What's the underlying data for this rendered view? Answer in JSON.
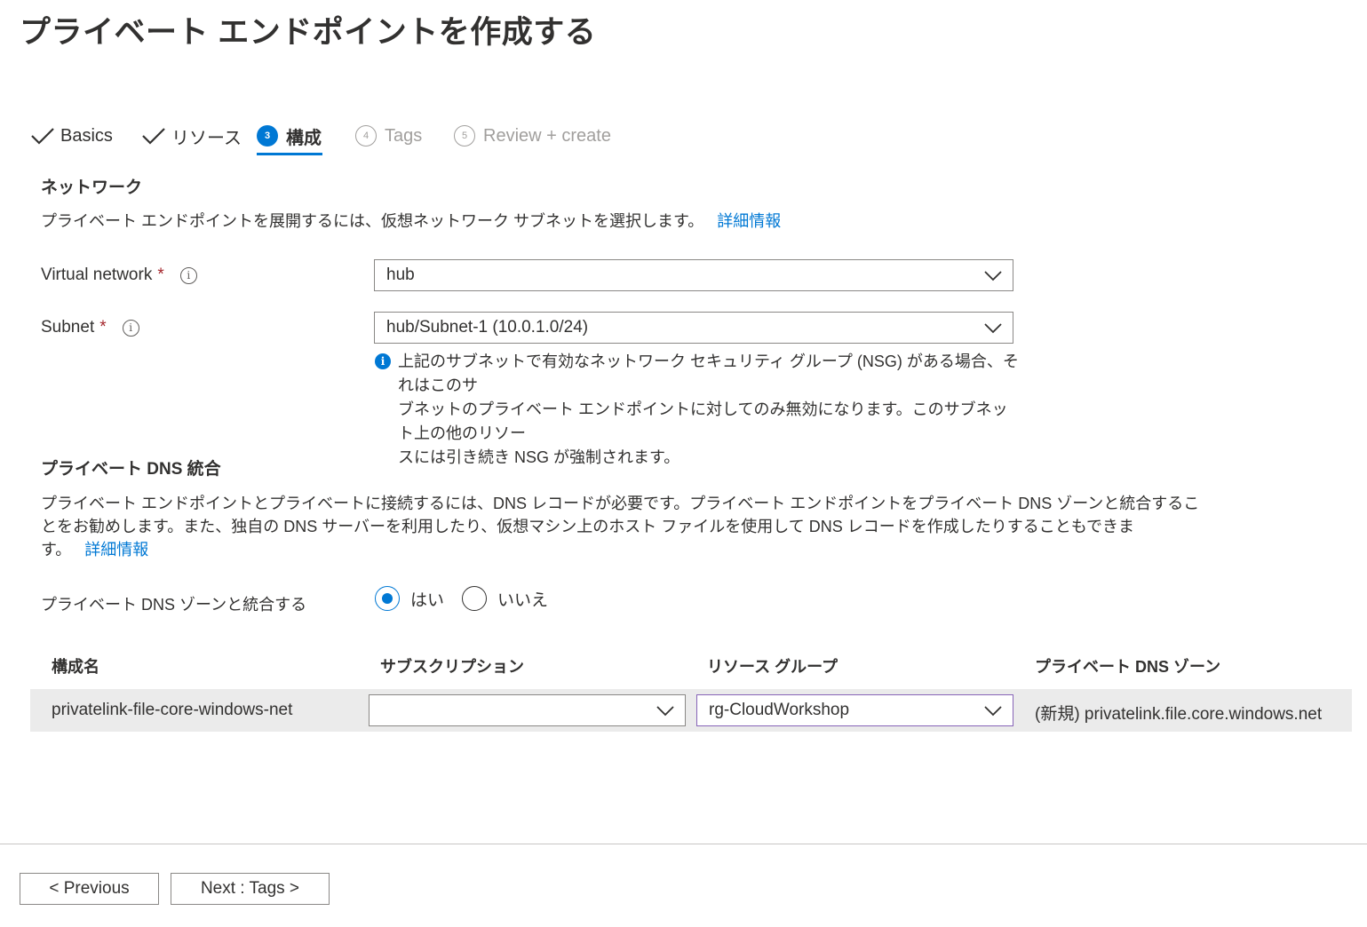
{
  "page": {
    "title": "プライベート エンドポイントを作成する",
    "more": "···"
  },
  "tabs": [
    {
      "label": "Basics",
      "state": "done"
    },
    {
      "label": "リソース",
      "state": "done"
    },
    {
      "label": "構成",
      "number": "3",
      "state": "active"
    },
    {
      "label": "Tags",
      "number": "4",
      "state": "future"
    },
    {
      "label": "Review + create",
      "number": "5",
      "state": "future"
    }
  ],
  "network": {
    "heading": "ネットワーク",
    "description": "プライベート エンドポイントを展開するには、仮想ネットワーク サブネットを選択します。",
    "learn_more": "詳細情報",
    "vnet_label": "Virtual network",
    "vnet_value": "hub",
    "subnet_label": "Subnet",
    "subnet_value": "hub/Subnet-1 (10.0.1.0/24)",
    "required_mark": "*",
    "info_glyph": "i",
    "nsg_info_line1": "上記のサブネットで有効なネットワーク セキュリティ グループ (NSG) がある場合、それはこのサ",
    "nsg_info_line2": "ブネットのプライベート エンドポイントに対してのみ無効になります。このサブネット上の他のリソー",
    "nsg_info_line3": "スには引き続き NSG が強制されます。"
  },
  "dns": {
    "heading": "プライベート DNS 統合",
    "desc_line1": "プライベート エンドポイントとプライベートに接続するには、DNS レコードが必要です。プライベート エンドポイントをプライベート DNS ゾーンと統合するこ",
    "desc_line2": "とをお勧めします。また、独自の DNS サーバーを利用したり、仮想マシン上のホスト ファイルを使用して DNS レコードを作成したりすることもできま",
    "desc_line3": "す。",
    "learn_more": "詳細情報",
    "integrate_label": "プライベート DNS ゾーンと統合する",
    "option_yes": "はい",
    "option_no": "いいえ",
    "selected": "yes"
  },
  "table": {
    "headers": [
      "構成名",
      "サブスクリプション",
      "リソース グループ",
      "プライベート DNS ゾーン"
    ],
    "row": {
      "config_name": "privatelink-file-core-windows-net",
      "subscription": "",
      "resource_group": "rg-CloudWorkshop",
      "dns_zone": "(新規) privatelink.file.core.windows.net"
    }
  },
  "footer": {
    "previous": "< Previous",
    "next": "Next : Tags >"
  },
  "colors": {
    "accent": "#0078d4",
    "required": "#a4262c",
    "row_bg": "#ebebeb",
    "focus_border": "#8764b8"
  }
}
